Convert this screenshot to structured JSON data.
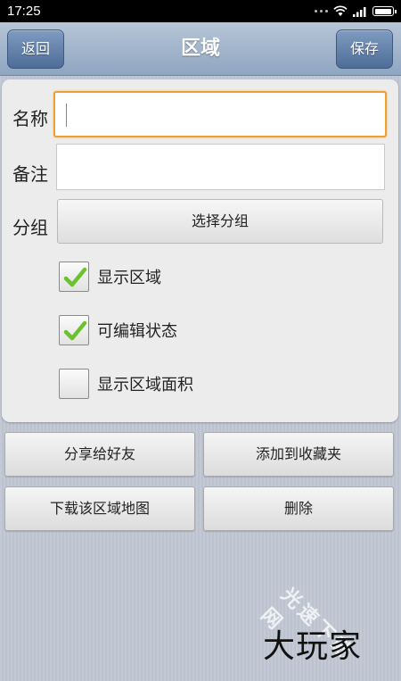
{
  "status_bar": {
    "time": "17:25"
  },
  "header": {
    "title": "区域",
    "back_label": "返回",
    "save_label": "保存"
  },
  "form": {
    "name_label": "名称",
    "name_value": "",
    "remark_label": "备注",
    "remark_value": "",
    "group_label": "分组",
    "group_button_label": "选择分组",
    "checkboxes": [
      {
        "label": "显示区域",
        "checked": true
      },
      {
        "label": "可编辑状态",
        "checked": true
      },
      {
        "label": "显示区域面积",
        "checked": false
      }
    ]
  },
  "actions": {
    "share_label": "分享给好友",
    "favorite_label": "添加到收藏夹",
    "download_label": "下载该区域地图",
    "delete_label": "删除"
  },
  "watermark": {
    "logo_text": "大玩家",
    "side_text": "光速下载网"
  },
  "colors": {
    "accent_focus": "#f0a030",
    "nav_button": "#5a78a2",
    "check_mark": "#6cc22e"
  }
}
